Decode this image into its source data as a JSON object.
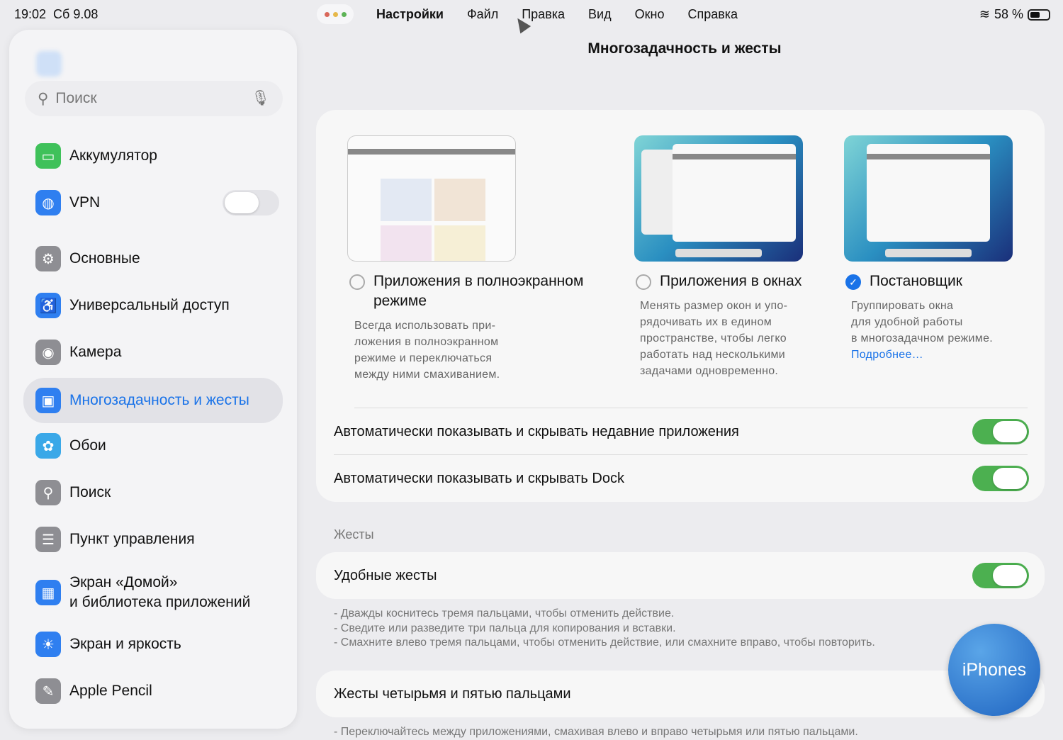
{
  "status": {
    "time": "19:02",
    "date": "Сб 9.08",
    "battery": "58 %"
  },
  "menubar": {
    "items": [
      "Настройки",
      "Файл",
      "Правка",
      "Вид",
      "Окно",
      "Справка"
    ]
  },
  "page_title": "Многозадачность и жесты",
  "sidebar": {
    "search_placeholder": "Поиск",
    "items": [
      {
        "label": "Аккумулятор",
        "icon": "battery-icon",
        "color": "#3fc15a"
      },
      {
        "label": "VPN",
        "icon": "globe-icon",
        "color": "#2f7ff0"
      },
      {
        "label": "Основные",
        "icon": "gear-icon",
        "color": "#8e8e93"
      },
      {
        "label": "Универсальный доступ",
        "icon": "accessibility-icon",
        "color": "#2f7ff0"
      },
      {
        "label": "Камера",
        "icon": "camera-icon",
        "color": "#8e8e93"
      },
      {
        "label": "Многозадачность и жесты",
        "icon": "multitasking-icon",
        "color": "#2f7ff0"
      },
      {
        "label": "Обои",
        "icon": "flower-icon",
        "color": "#3aa8e8"
      },
      {
        "label": "Поиск",
        "icon": "search-icon",
        "color": "#8e8e93"
      },
      {
        "label": "Пункт управления",
        "icon": "switches-icon",
        "color": "#8e8e93"
      },
      {
        "label": "Экран «Домой»\nи библиотека приложений",
        "line1": "Экран «Домой»",
        "line2": "и библиотека приложений",
        "icon": "home-screen-icon",
        "color": "#2f7ff0"
      },
      {
        "label": "Экран и яркость",
        "icon": "sun-icon",
        "color": "#2f7ff0"
      },
      {
        "label": "Apple Pencil",
        "icon": "pencil-icon",
        "color": "#8e8e93"
      }
    ]
  },
  "modes": [
    {
      "title": "Приложения в полноэкранном режиме",
      "line1": "Приложения в полноэкранном",
      "line2": "режиме",
      "desc": [
        "Всегда использовать при-",
        "ложения в полноэкранном",
        "режиме и переключаться",
        "между ними смахиванием."
      ],
      "selected": false
    },
    {
      "title": "Приложения в окнах",
      "desc": [
        "Менять размер окон и упо-",
        "рядочивать их в едином",
        "пространстве, чтобы легко",
        "работать над несколькими",
        "задачами одновременно."
      ],
      "selected": false
    },
    {
      "title": "Постановщик",
      "desc": [
        "Группировать окна",
        "для удобной работы",
        "в многозадачном режиме."
      ],
      "link": "Подробнее…",
      "selected": true
    }
  ],
  "toggles": {
    "recent_apps": {
      "label": "Автоматически показывать и скрывать недавние приложения",
      "on": true
    },
    "dock": {
      "label": "Автоматически показывать и скрывать Dock",
      "on": true
    }
  },
  "gestures": {
    "header": "Жесты",
    "convenient": {
      "label": "Удобные жесты",
      "on": true
    },
    "notes": [
      "- Дважды коснитесь тремя пальцами, чтобы отменить действие.",
      "- Сведите или разведите три пальца для копирования и вставки.",
      "- Смахните влево тремя пальцами, чтобы отменить действие, или смахните вправо, чтобы повторить."
    ],
    "four_five": {
      "label": "Жесты четырьмя и пятью пальцами"
    },
    "four_five_note": "- Переключайтесь между приложениями, смахивая влево и вправо четырьмя или пятью пальцами."
  },
  "watermark": "iPhones"
}
